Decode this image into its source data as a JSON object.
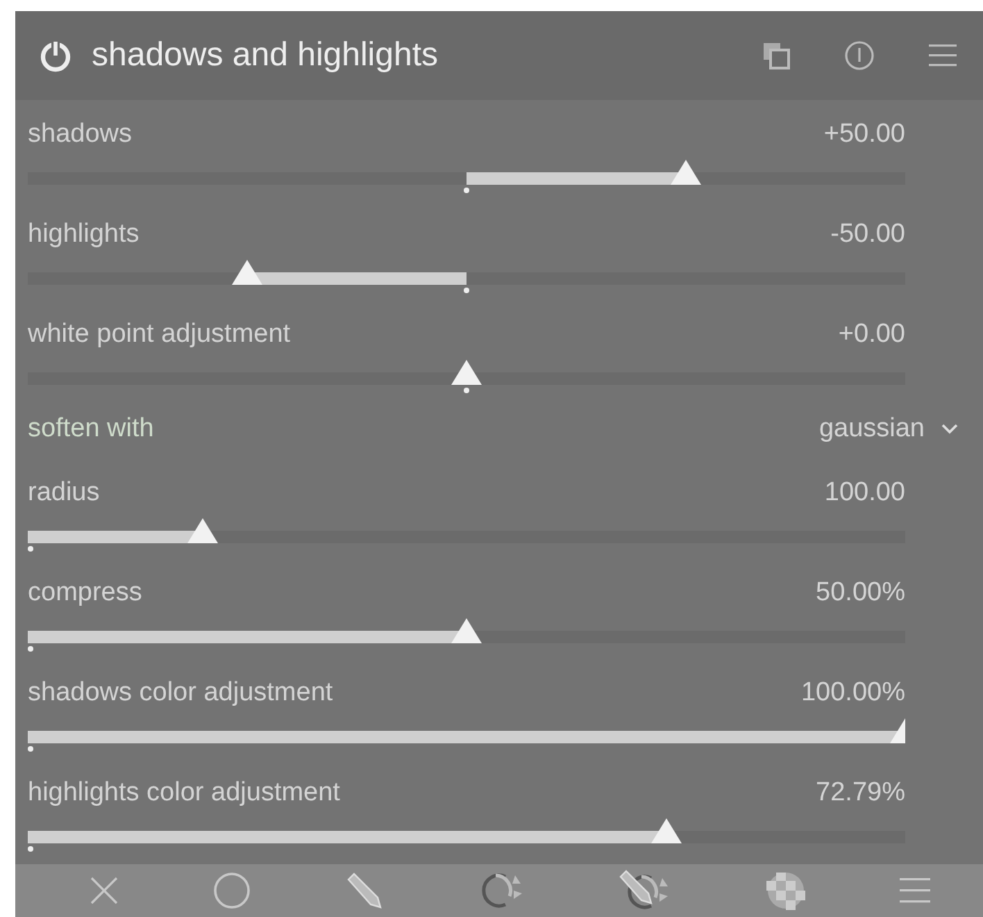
{
  "module": {
    "title": "shadows and highlights"
  },
  "rows": [
    {
      "kind": "slider",
      "label": "shadows",
      "value": "+50.00",
      "level": 0.75,
      "bipolar": true
    },
    {
      "kind": "slider",
      "label": "highlights",
      "value": "-50.00",
      "level": 0.25,
      "bipolar": true
    },
    {
      "kind": "slider",
      "label": "white point adjustment",
      "value": "+0.00",
      "level": 0.5,
      "bipolar": true
    },
    {
      "kind": "combo",
      "label": "soften with",
      "value": "gaussian"
    },
    {
      "kind": "slider",
      "label": "radius",
      "value": "100.00",
      "level": 0.2,
      "bipolar": false
    },
    {
      "kind": "slider",
      "label": "compress",
      "value": "50.00%",
      "level": 0.5,
      "bipolar": false
    },
    {
      "kind": "slider",
      "label": "shadows color adjustment",
      "value": "100.00%",
      "level": 1.0,
      "bipolar": false
    },
    {
      "kind": "slider",
      "label": "highlights color adjustment",
      "value": "72.79%",
      "level": 0.728,
      "bipolar": false
    }
  ]
}
